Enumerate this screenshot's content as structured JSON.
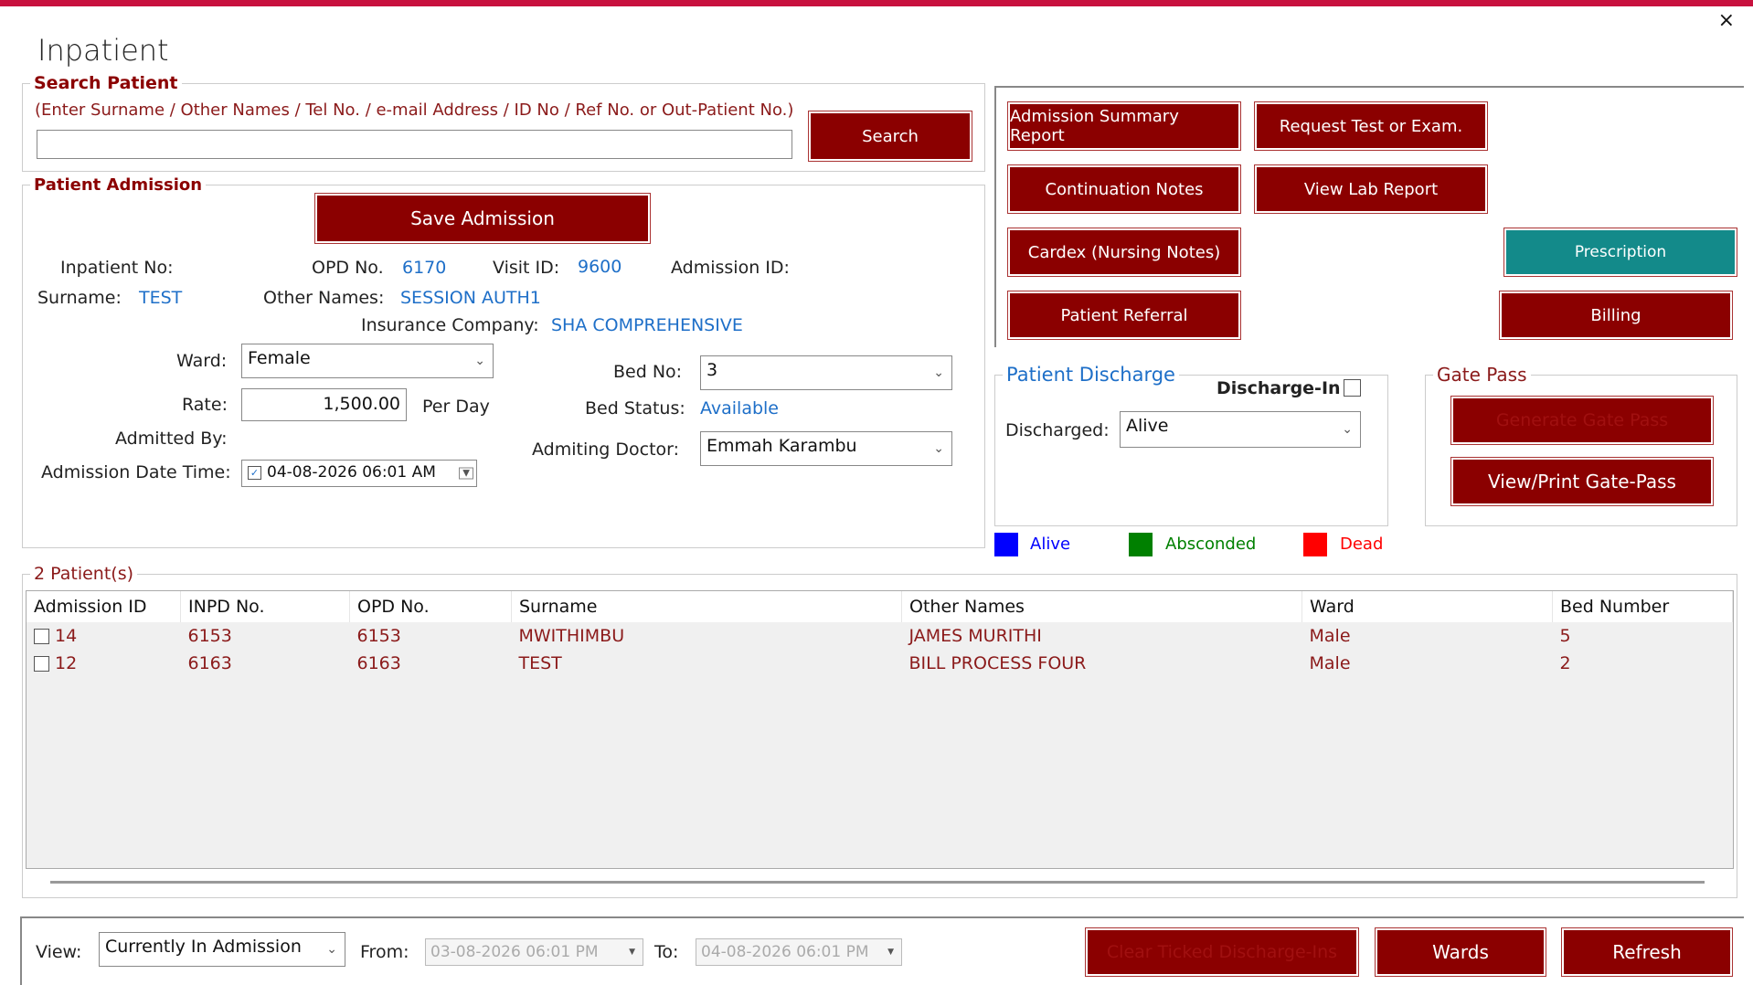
{
  "window": {
    "title": "Inpatient",
    "close": "×"
  },
  "search": {
    "legend": "Search Patient",
    "hint": "(Enter Surname / Other Names / Tel No. / e-mail Address / ID No / Ref No. or Out-Patient No.)",
    "value": "",
    "button": "Search"
  },
  "actions": {
    "admission_summary": "Admission Summary Report",
    "request_test": "Request Test or Exam.",
    "continuation_notes": "Continuation Notes",
    "view_lab": "View Lab Report",
    "cardex": "Cardex (Nursing Notes)",
    "prescription": "Prescription",
    "referral": "Patient Referral",
    "billing": "Billing"
  },
  "admission": {
    "legend": "Patient Admission",
    "save": "Save Admission",
    "inpatient_no_label": "Inpatient No:",
    "opd_label": "OPD No.",
    "opd_value": "6170",
    "visit_label": "Visit ID:",
    "visit_value": "9600",
    "admission_id_label": "Admission ID:",
    "surname_label": "Surname:",
    "surname_value": "TEST",
    "other_names_label": "Other Names:",
    "other_names_value": "SESSION AUTH1",
    "insurance_label": "Insurance Company:",
    "insurance_value": "SHA COMPREHENSIVE",
    "ward_label": "Ward:",
    "ward_value": "Female",
    "bed_label": "Bed No:",
    "bed_value": "3",
    "rate_label": "Rate:",
    "rate_value": "1,500.00",
    "per_day": "Per Day",
    "bed_status_label": "Bed Status:",
    "bed_status_value": "Available",
    "admitted_by_label": "Admitted By:",
    "doctor_label": "Admiting Doctor:",
    "doctor_value": "Emmah Karambu",
    "datetime_label": "Admission Date Time:",
    "datetime_value": "04-08-2026  06:01 AM"
  },
  "discharge": {
    "legend": "Patient Discharge",
    "discharge_in": "Discharge-In",
    "discharged_label": "Discharged:",
    "discharged_value": "Alive"
  },
  "gatepass": {
    "legend": "Gate Pass",
    "generate": "Generate Gate Pass",
    "view_print": "View/Print Gate-Pass"
  },
  "legend_keys": [
    {
      "label": "Alive",
      "color": "#0000ff"
    },
    {
      "label": "Absconded",
      "color": "#008000"
    },
    {
      "label": "Dead",
      "color": "#ff0000"
    }
  ],
  "patients": {
    "legend": "2 Patient(s)",
    "columns": [
      "Admission ID",
      "INPD No.",
      "OPD No.",
      "Surname",
      "Other Names",
      "Ward",
      "Bed Number"
    ],
    "rows": [
      [
        "14",
        "6153",
        "6153",
        "MWITHIMBU",
        "JAMES MURITHI",
        "Male",
        "5"
      ],
      [
        "12",
        "6163",
        "6163",
        "TEST",
        "BILL PROCESS FOUR",
        "Male",
        "2"
      ]
    ]
  },
  "footer": {
    "view_label": "View:",
    "view_value": "Currently In Admission",
    "from_label": "From:",
    "from_value": "03-08-2026  06:01 PM",
    "to_label": "To:",
    "to_value": "04-08-2026  06:01 PM",
    "clear": "Clear Ticked Discharge-Ins",
    "wards": "Wards",
    "refresh": "Refresh"
  }
}
